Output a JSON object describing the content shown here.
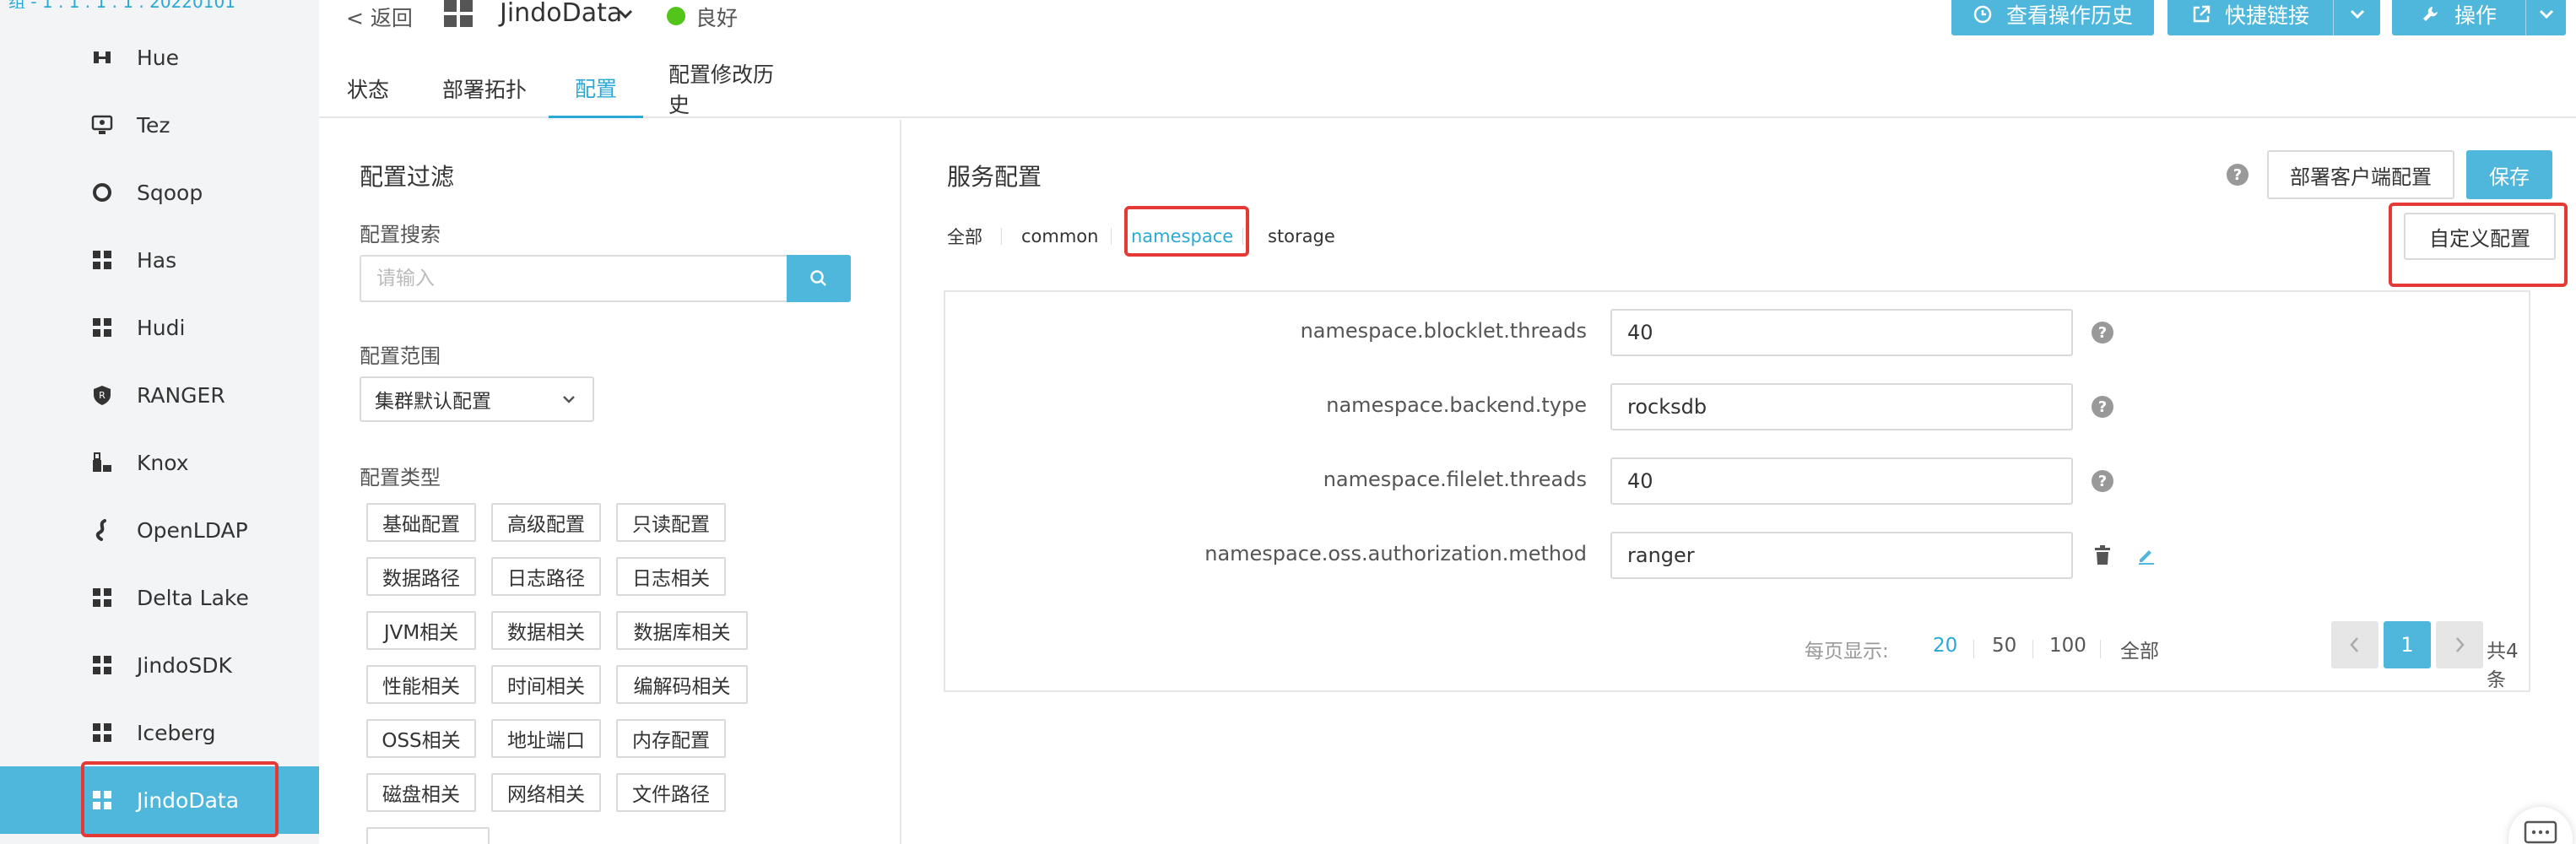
{
  "sidebar": {
    "top_cut_text": "组 - 1 . 1 . 1 . 1 . 20220101",
    "items": [
      {
        "label": "Hue",
        "icon": "hue-icon"
      },
      {
        "label": "Tez",
        "icon": "tez-icon"
      },
      {
        "label": "Sqoop",
        "icon": "sqoop-icon"
      },
      {
        "label": "Has",
        "icon": "grid-icon"
      },
      {
        "label": "Hudi",
        "icon": "grid-icon"
      },
      {
        "label": "RANGER",
        "icon": "ranger-shield-icon"
      },
      {
        "label": "Knox",
        "icon": "knox-icon"
      },
      {
        "label": "OpenLDAP",
        "icon": "openldap-icon"
      },
      {
        "label": "Delta Lake",
        "icon": "grid-icon"
      },
      {
        "label": "JindoSDK",
        "icon": "grid-icon"
      },
      {
        "label": "Iceberg",
        "icon": "grid-icon"
      },
      {
        "label": "JindoData",
        "icon": "grid-icon",
        "active": true
      }
    ]
  },
  "header": {
    "back": "< 返回",
    "service_name": "JindoData",
    "status": "良好",
    "status_color": "#52c41a",
    "accent_color": "#4fb7dc",
    "buttons": {
      "history": "查看操作历史",
      "quick_links": "快捷链接",
      "actions": "操作"
    }
  },
  "tabs": [
    "状态",
    "部署拓扑",
    "配置",
    "配置修改历史"
  ],
  "active_tab": "配置",
  "filter": {
    "title": "配置过滤",
    "search_label": "配置搜索",
    "search_placeholder": "请输入",
    "range_label": "配置范围",
    "range_value": "集群默认配置",
    "type_label": "配置类型",
    "tags": [
      "基础配置",
      "高级配置",
      "只读配置",
      "数据路径",
      "日志路径",
      "日志相关",
      "JVM相关",
      "数据相关",
      "数据库相关",
      "性能相关",
      "时间相关",
      "编解码相关",
      "OSS相关",
      "地址端口",
      "内存配置",
      "磁盘相关",
      "网络相关",
      "文件路径"
    ]
  },
  "service_config": {
    "title": "服务配置",
    "deploy_client_config": "部署客户端配置",
    "save": "保存",
    "custom_config": "自定义配置",
    "sub_tabs": [
      "全部",
      "common",
      "namespace",
      "storage"
    ],
    "active_sub_tab": "namespace",
    "rows": [
      {
        "key": "namespace.blocklet.threads",
        "value": "40",
        "kind": "help"
      },
      {
        "key": "namespace.backend.type",
        "value": "rocksdb",
        "kind": "help"
      },
      {
        "key": "namespace.filelet.threads",
        "value": "40",
        "kind": "help"
      },
      {
        "key": "namespace.oss.authorization.method",
        "value": "ranger",
        "kind": "custom"
      }
    ],
    "pager": {
      "per_page_label": "每页显示:",
      "sizes": [
        "20",
        "50",
        "100",
        "全部"
      ],
      "active_size": "20",
      "current_page": "1",
      "total": "共4条"
    }
  },
  "highlight_color": "#e53935"
}
